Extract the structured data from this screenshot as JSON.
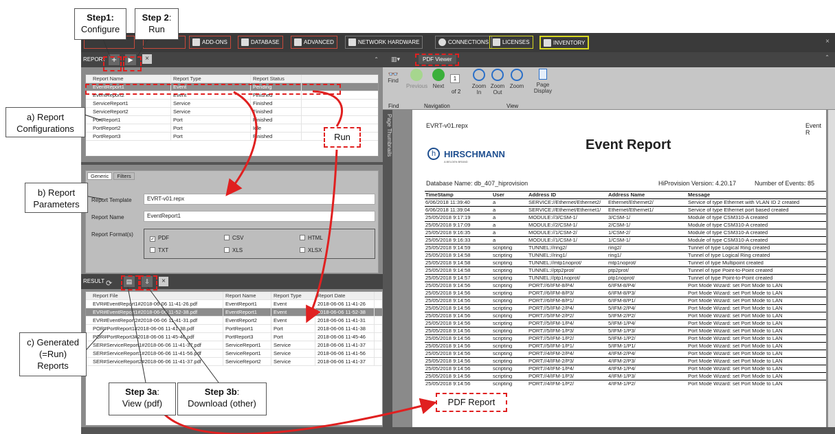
{
  "toolbar": {
    "items": [
      {
        "label": "ADD-ONS"
      },
      {
        "label": "DATABASE"
      },
      {
        "label": "ADVANCED"
      },
      {
        "label": "NETWORK HARDWARE"
      },
      {
        "label": "CONNECTIONS"
      },
      {
        "label": "LICENSES"
      },
      {
        "label": "INVENTORY"
      }
    ]
  },
  "report_panel": {
    "title": "REPORT",
    "headers": [
      "Report Name",
      "Report Type",
      "Report Status"
    ],
    "rows": [
      [
        "EventReport1",
        "Event",
        "Pending"
      ],
      [
        "EventReport2",
        "Event",
        "Finished"
      ],
      [
        "ServiceReport1",
        "Service",
        "Finished"
      ],
      [
        "ServiceReport2",
        "Service",
        "Finished"
      ],
      [
        "PortReport1",
        "Port",
        "Finished"
      ],
      [
        "PortReport2",
        "Port",
        "Idle"
      ],
      [
        "PortReport3",
        "Port",
        "Finished"
      ]
    ]
  },
  "params": {
    "tabs": [
      "Generic",
      "Filters"
    ],
    "template_label": "Report Template",
    "template_value": "EVRT-v01.repx",
    "name_label": "Report Name",
    "name_value": "EventReport1",
    "formats_label": "Report Format(s)",
    "formats": [
      "PDF",
      "CSV",
      "HTML",
      "TXT",
      "XLS",
      "XLSX"
    ]
  },
  "result_panel": {
    "title": "RESULT",
    "headers": [
      "Report File",
      "Report Name",
      "Report Type",
      "Report Date"
    ],
    "rows": [
      [
        "EVR#EventReport1#2018-06-06 11-41-26.pdf",
        "EventReport1",
        "Event",
        "2018-06-06 11-41-26"
      ],
      [
        "EVR#EventReport1#2018-06-06 11-52-38.pdf",
        "EventReport1",
        "Event",
        "2018-06-06 11-52-38"
      ],
      [
        "EVR#EventReport2#2018-06-06 11-41-31.pdf",
        "EventReport2",
        "Event",
        "2018-06-06 11-41-31"
      ],
      [
        "POR#PortReport1#2018-06-06 11-41-38.pdf",
        "PortReport1",
        "Port",
        "2018-06-06 11-41-38"
      ],
      [
        "POR#PortReport3#2018-06-06 11-45-46.pdf",
        "PortReport3",
        "Port",
        "2018-06-06 11-45-46"
      ],
      [
        "SER#ServiceReport1#2018-06-06 11-41-37.pdf",
        "ServiceReport1",
        "Service",
        "2018-06-06 11-41-37"
      ],
      [
        "SER#ServiceReport1#2018-06-06 11-41-56.pdf",
        "ServiceReport1",
        "Service",
        "2018-06-06 11-41-56"
      ],
      [
        "SER#ServiceReport2#2018-06-06 11-41-37.pdf",
        "ServiceReport2",
        "Service",
        "2018-06-06 11-41-37"
      ]
    ]
  },
  "viewer": {
    "tab": "PDF Viewer",
    "page": "1",
    "of": "of 2",
    "thumbs": "Page Thumbnails",
    "buttons": {
      "find": "Find",
      "previous": "Previous",
      "next": "Next",
      "zoom_in": "Zoom In",
      "zoom_out": "Zoom Out",
      "zoom": "Zoom",
      "page_display": "Page Display"
    },
    "groups": {
      "find": "Find",
      "navigation": "Navigation",
      "view": "View"
    }
  },
  "doc": {
    "file": "EVRT-v01.repx",
    "header_right": "Event R",
    "logo": "HIRSCHMANN",
    "logo_sub": "A BELDEN BRAND",
    "title": "Event Report",
    "db": "Database Name: db_407_hiprovision",
    "version": "HiProvision Version: 4.20.17",
    "events": "Number of Events: 85",
    "headers": [
      "TimeStamp",
      "User",
      "Address ID",
      "Address Name",
      "Message"
    ],
    "rows": [
      [
        "6/06/2018 11:39:40",
        "a",
        "SERVICE://Ethernet/Ethernet2/",
        "Ethernet/Ethernet2/",
        "Service of type Ethernet with VLAN ID 2 created"
      ],
      [
        "6/06/2018 11:39:04",
        "a",
        "SERVICE://Ethernet/Ethernet1/",
        "Ethernet/Ethernet1/",
        "Service of type Ethernet port based created"
      ],
      [
        "25/05/2018 9:17:19",
        "a",
        "MODULE://3/CSM-1/",
        "3/CSM-1/",
        "Module of type CSM310-A created"
      ],
      [
        "25/05/2018 9:17:09",
        "a",
        "MODULE://2/CSM-1/",
        "2/CSM-1/",
        "Module of type CSM310-A created"
      ],
      [
        "25/05/2018 9:16:35",
        "a",
        "MODULE://1/CSM-2/",
        "1/CSM-2/",
        "Module of type CSM310-A created"
      ],
      [
        "25/05/2018 9:16:33",
        "a",
        "MODULE://1/CSM-1/",
        "1/CSM-1/",
        "Module of type CSM310-A created"
      ],
      [
        "25/05/2018 9:14:59",
        "scripting",
        "TUNNEL://ring2/",
        "ring2/",
        "Tunnel of type Logical Ring created"
      ],
      [
        "25/05/2018 9:14:58",
        "scripting",
        "TUNNEL://ring1/",
        "ring1/",
        "Tunnel of type Logical Ring created"
      ],
      [
        "25/05/2018 9:14:58",
        "scripting",
        "TUNNEL://mtp1noprot/",
        "mtp1noprot/",
        "Tunnel of type Multipoint created"
      ],
      [
        "25/05/2018 9:14:58",
        "scripting",
        "TUNNEL://ptp2prot/",
        "ptp2prot/",
        "Tunnel of type Point-to-Point created"
      ],
      [
        "25/05/2018 9:14:57",
        "scripting",
        "TUNNEL://ptp1noprot/",
        "ptp1noprot/",
        "Tunnel of type Point-to-Point created"
      ],
      [
        "25/05/2018 9:14:56",
        "scripting",
        "PORT://6/IFM-8/P4/",
        "6/IFM-8/P4/",
        "Port Mode Wizard: set Port Mode to LAN"
      ],
      [
        "25/05/2018 9:14:56",
        "scripting",
        "PORT://6/IFM-8/P3/",
        "6/IFM-8/P3/",
        "Port Mode Wizard: set Port Mode to LAN"
      ],
      [
        "25/05/2018 9:14:56",
        "scripting",
        "PORT://6/IFM-8/P1/",
        "6/IFM-8/P1/",
        "Port Mode Wizard: set Port Mode to LAN"
      ],
      [
        "25/05/2018 9:14:56",
        "scripting",
        "PORT://5/IFM-2/P4/",
        "5/IFM-2/P4/",
        "Port Mode Wizard: set Port Mode to LAN"
      ],
      [
        "25/05/2018 9:14:56",
        "scripting",
        "PORT://5/IFM-2/P2/",
        "5/IFM-2/P2/",
        "Port Mode Wizard: set Port Mode to LAN"
      ],
      [
        "25/05/2018 9:14:56",
        "scripting",
        "PORT://5/IFM-1/P4/",
        "5/IFM-1/P4/",
        "Port Mode Wizard: set Port Mode to LAN"
      ],
      [
        "25/05/2018 9:14:56",
        "scripting",
        "PORT://5/IFM-1/P3/",
        "5/IFM-1/P3/",
        "Port Mode Wizard: set Port Mode to LAN"
      ],
      [
        "25/05/2018 9:14:56",
        "scripting",
        "PORT://5/IFM-1/P2/",
        "5/IFM-1/P2/",
        "Port Mode Wizard: set Port Mode to LAN"
      ],
      [
        "25/05/2018 9:14:56",
        "scripting",
        "PORT://5/IFM-1/P1/",
        "5/IFM-1/P1/",
        "Port Mode Wizard: set Port Mode to LAN"
      ],
      [
        "25/05/2018 9:14:56",
        "scripting",
        "PORT://4/IFM-2/P4/",
        "4/IFM-2/P4/",
        "Port Mode Wizard: set Port Mode to LAN"
      ],
      [
        "25/05/2018 9:14:56",
        "scripting",
        "PORT://4/IFM-2/P3/",
        "4/IFM-2/P3/",
        "Port Mode Wizard: set Port Mode to LAN"
      ],
      [
        "25/05/2018 9:14:56",
        "scripting",
        "PORT://4/IFM-1/P4/",
        "4/IFM-1/P4/",
        "Port Mode Wizard: set Port Mode to LAN"
      ],
      [
        "25/05/2018 9:14:56",
        "scripting",
        "PORT://4/IFM-1/P3/",
        "4/IFM-1/P3/",
        "Port Mode Wizard: set Port Mode to LAN"
      ],
      [
        "25/05/2018 9:14:56",
        "scripting",
        "PORT://4/IFM-1/P2/",
        "4/IFM-1/P2/",
        "Port Mode Wizard: set Port Mode to LAN"
      ]
    ]
  },
  "callouts": {
    "step1a": "Step1:",
    "step1b": "Configure",
    "step2a": "Step 2",
    "step2b": ": ",
    "step2c": "Run",
    "a1": "a) Report",
    "a2": "Configurations",
    "b1": "b) Report",
    "b2": "Parameters",
    "c1": "c) Generated",
    "c2": "(=Run)",
    "c3": "Reports",
    "run": "Run",
    "s3a1": "Step 3a",
    "s3a2": ":",
    "s3a3": "View (pdf)",
    "s3b1": "Step 3b",
    "s3b2": ":",
    "s3b3": "Download (other)",
    "pdf": "PDF Report"
  },
  "colors": {
    "accent": "#e02020",
    "inventory": "#d8d820"
  }
}
